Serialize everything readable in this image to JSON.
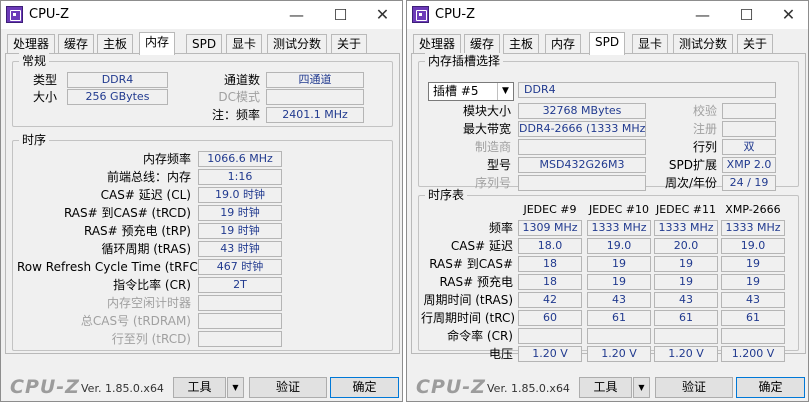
{
  "app": {
    "title": "CPU-Z",
    "min_glyph": "—",
    "max_glyph": "☐",
    "close_glyph": "✕",
    "logo": "CPU-Z",
    "version": "Ver. 1.85.0.x64",
    "tools_label": "工具",
    "validate_label": "验证",
    "ok_label": "确定",
    "dropdown_glyph": "▼"
  },
  "tabs": [
    "处理器",
    "缓存",
    "主板",
    "内存",
    "SPD",
    "显卡",
    "测试分数",
    "关于"
  ],
  "memory": {
    "general": {
      "legend": "常规",
      "type_label": "类型",
      "type_value": "DDR4",
      "size_label": "大小",
      "size_value": "256 GBytes",
      "channels_label": "通道数",
      "channels_value": "四通道",
      "dc_label": "DC模式",
      "dc_value": "",
      "note_label": "注：频率",
      "note_value": "2401.1 MHz"
    },
    "timings": {
      "legend": "时序",
      "rows": [
        {
          "label": "内存频率",
          "value": "1066.6 MHz",
          "dim": false
        },
        {
          "label": "前端总线：内存",
          "value": "1:16",
          "dim": false
        },
        {
          "label": "CAS# 延迟 (CL)",
          "value": "19.0 时钟",
          "dim": false
        },
        {
          "label": "RAS# 到CAS# (tRCD)",
          "value": "19 时钟",
          "dim": false
        },
        {
          "label": "RAS# 预充电 (tRP)",
          "value": "19 时钟",
          "dim": false
        },
        {
          "label": "循环周期 (tRAS)",
          "value": "43 时钟",
          "dim": false
        },
        {
          "label": "Row Refresh Cycle Time (tRFC)",
          "value": "467 时钟",
          "dim": false
        },
        {
          "label": "指令比率 (CR)",
          "value": "2T",
          "dim": false
        },
        {
          "label": "内存空闲计时器",
          "value": "",
          "dim": true
        },
        {
          "label": "总CAS号 (tRDRAM)",
          "value": "",
          "dim": true
        },
        {
          "label": "行至列 (tRCD)",
          "value": "",
          "dim": true
        }
      ]
    }
  },
  "spd": {
    "slot": {
      "legend": "内存插槽选择",
      "slot_value": "插槽 #5",
      "type_value": "DDR4",
      "module_size_label": "模块大小",
      "module_size_value": "32768 MBytes",
      "max_bw_label": "最大带宽",
      "max_bw_value": "DDR4-2666 (1333 MHz)",
      "manufacturer_label": "制造商",
      "manufacturer_value": "",
      "part_label": "型号",
      "part_value": "MSD432G26M3",
      "serial_label": "序列号",
      "serial_value": "",
      "check_label": "校验",
      "check_value": "",
      "reg_label": "注册",
      "reg_value": "",
      "rank_label": "行列",
      "rank_value": "双",
      "ext_label": "SPD扩展",
      "ext_value": "XMP 2.0",
      "week_label": "周次/年份",
      "week_value": "24 / 19"
    },
    "timing_table": {
      "legend": "时序表",
      "columns": [
        "JEDEC #9",
        "JEDEC #10",
        "JEDEC #11",
        "XMP-2666"
      ],
      "rows": [
        {
          "label": "频率",
          "values": [
            "1309 MHz",
            "1333 MHz",
            "1333 MHz",
            "1333 MHz"
          ]
        },
        {
          "label": "CAS# 延迟",
          "values": [
            "18.0",
            "19.0",
            "20.0",
            "19.0"
          ]
        },
        {
          "label": "RAS# 到CAS#",
          "values": [
            "18",
            "19",
            "19",
            "19"
          ]
        },
        {
          "label": "RAS# 预充电",
          "values": [
            "18",
            "19",
            "19",
            "19"
          ]
        },
        {
          "label": "周期时间 (tRAS)",
          "values": [
            "42",
            "43",
            "43",
            "43"
          ]
        },
        {
          "label": "行周期时间 (tRC)",
          "values": [
            "60",
            "61",
            "61",
            "61"
          ]
        },
        {
          "label": "命令率 (CR)",
          "values": [
            "",
            "",
            "",
            ""
          ]
        },
        {
          "label": "电压",
          "values": [
            "1.20 V",
            "1.20 V",
            "1.20 V",
            "1.200 V"
          ]
        }
      ]
    }
  }
}
